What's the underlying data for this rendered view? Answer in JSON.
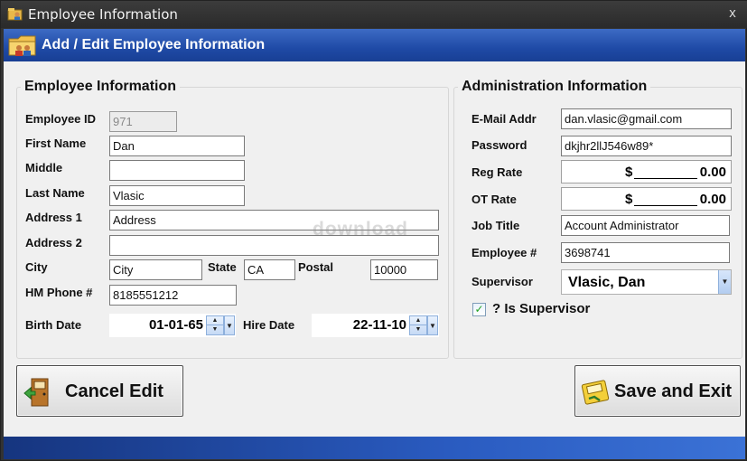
{
  "window": {
    "title": "Employee Information",
    "close_glyph": "x"
  },
  "banner": {
    "title": "Add / Edit Employee Information"
  },
  "employee": {
    "legend": "Employee Information",
    "employee_id": {
      "label": "Employee ID",
      "value": "971"
    },
    "first_name": {
      "label": "First Name",
      "value": "Dan"
    },
    "middle": {
      "label": "Middle",
      "value": ""
    },
    "last_name": {
      "label": "Last Name",
      "value": "Vlasic"
    },
    "address1": {
      "label": "Address 1",
      "value": "Address"
    },
    "address2": {
      "label": "Address 2",
      "value": ""
    },
    "city": {
      "label": "City",
      "value": "City"
    },
    "state": {
      "label": "State",
      "value": "CA"
    },
    "postal": {
      "label": "Postal",
      "value": "10000"
    },
    "hm_phone": {
      "label": "HM Phone #",
      "value": "8185551212"
    },
    "birth_date": {
      "label": "Birth Date",
      "value": "01-01-65"
    },
    "hire_date": {
      "label": "Hire Date",
      "value": "22-11-10"
    }
  },
  "admin": {
    "legend": "Administration Information",
    "email": {
      "label": "E-Mail Addr",
      "value": "dan.vlasic@gmail.com"
    },
    "password": {
      "label": "Password",
      "value": "dkjhr2llJ546w89*"
    },
    "reg_rate": {
      "label": "Reg Rate",
      "currency": "$",
      "value": "0.00"
    },
    "ot_rate": {
      "label": "OT Rate",
      "currency": "$",
      "value": "0.00"
    },
    "job_title": {
      "label": "Job Title",
      "value": "Account Administrator"
    },
    "employee_no": {
      "label": "Employee #",
      "value": "3698741"
    },
    "supervisor": {
      "label": "Supervisor",
      "value": "Vlasic, Dan"
    },
    "is_supervisor": {
      "label": "? Is Supervisor",
      "checked": true
    }
  },
  "buttons": {
    "cancel": {
      "label": "Cancel Edit",
      "icon": "exit-door-icon"
    },
    "save": {
      "label": "Save and Exit",
      "icon": "save-exit-icon"
    }
  },
  "watermark": "download",
  "colors": {
    "banner": "#1f4aa6",
    "footer": "#2a5bc0",
    "titlebar": "#2e2e2e"
  }
}
